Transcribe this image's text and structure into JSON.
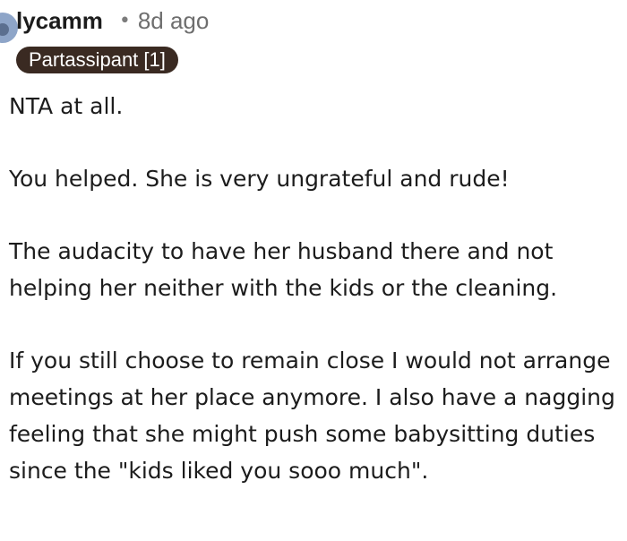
{
  "comment": {
    "username": "lycamm",
    "separator": "•",
    "time": "8d ago",
    "flair": "Partassipant [1]",
    "paragraphs": [
      "NTA at all.",
      "You helped. She is very ungrateful and rude!",
      "The audacity to have her husband there and not helping her neither with the kids or the cleaning.",
      "If you still choose to remain close I would not arrange meetings at her place anymore. I also have a nagging feeling that she might push some babysitting duties since the \"kids liked you sooo much\"."
    ]
  }
}
